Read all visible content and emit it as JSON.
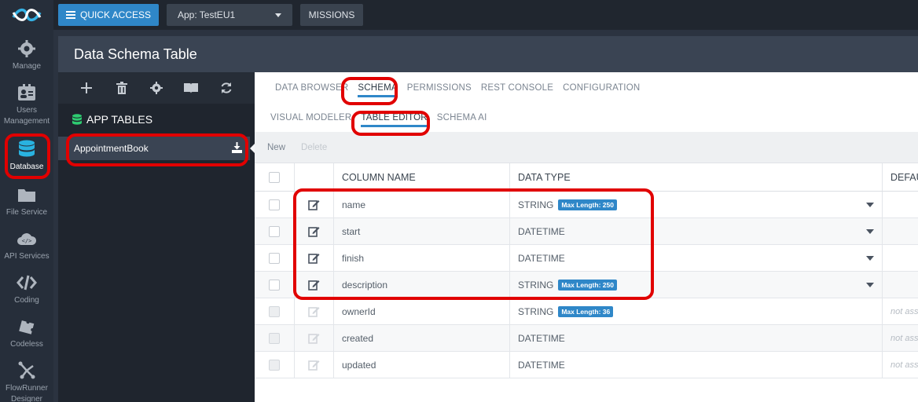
{
  "rail": {
    "items": [
      {
        "label": "Manage",
        "icon": "gear-icon"
      },
      {
        "label": "Users Management",
        "icon": "users-icon"
      },
      {
        "label": "Database",
        "icon": "database-icon"
      },
      {
        "label": "File Service",
        "icon": "folder-icon"
      },
      {
        "label": "API Services",
        "icon": "api-cloud-icon"
      },
      {
        "label": "Coding",
        "icon": "code-icon"
      },
      {
        "label": "Codeless",
        "icon": "codeless-icon"
      },
      {
        "label": "FlowRunner Designer",
        "icon": "flowrunner-icon"
      }
    ]
  },
  "topbar": {
    "quick_access": "QUICK ACCESS",
    "app_selector": "App: TestEU1",
    "missions": "MISSIONS"
  },
  "header": {
    "title": "Data Schema Table"
  },
  "tables_panel": {
    "section_title": "APP TABLES",
    "tables": [
      "AppointmentBook"
    ]
  },
  "tabs": [
    "DATA BROWSER",
    "SCHEMA",
    "PERMISSIONS",
    "REST CONSOLE",
    "CONFIGURATION"
  ],
  "subtabs": [
    "VISUAL MODELER",
    "TABLE EDITOR",
    "SCHEMA AI"
  ],
  "actions": {
    "new": "New",
    "delete": "Delete"
  },
  "table": {
    "headers": {
      "column_name": "COLUMN NAME",
      "data_type": "DATA TYPE",
      "default": "DEFAU"
    },
    "rows": [
      {
        "name": "name",
        "type": "STRING",
        "badge": "Max Length: 250",
        "default": ""
      },
      {
        "name": "start",
        "type": "DATETIME",
        "badge": "",
        "default": ""
      },
      {
        "name": "finish",
        "type": "DATETIME",
        "badge": "",
        "default": ""
      },
      {
        "name": "description",
        "type": "STRING",
        "badge": "Max Length: 250",
        "default": ""
      },
      {
        "name": "ownerId",
        "type": "STRING",
        "badge": "Max Length: 36",
        "default": "not ass"
      },
      {
        "name": "created",
        "type": "DATETIME",
        "badge": "",
        "default": "not ass"
      },
      {
        "name": "updated",
        "type": "DATETIME",
        "badge": "",
        "default": "not ass"
      }
    ]
  },
  "colors": {
    "accent": "#2f87c8",
    "highlight": "#e10000",
    "db_icon": "#29b2e0",
    "green_icon": "#2ecc71"
  }
}
